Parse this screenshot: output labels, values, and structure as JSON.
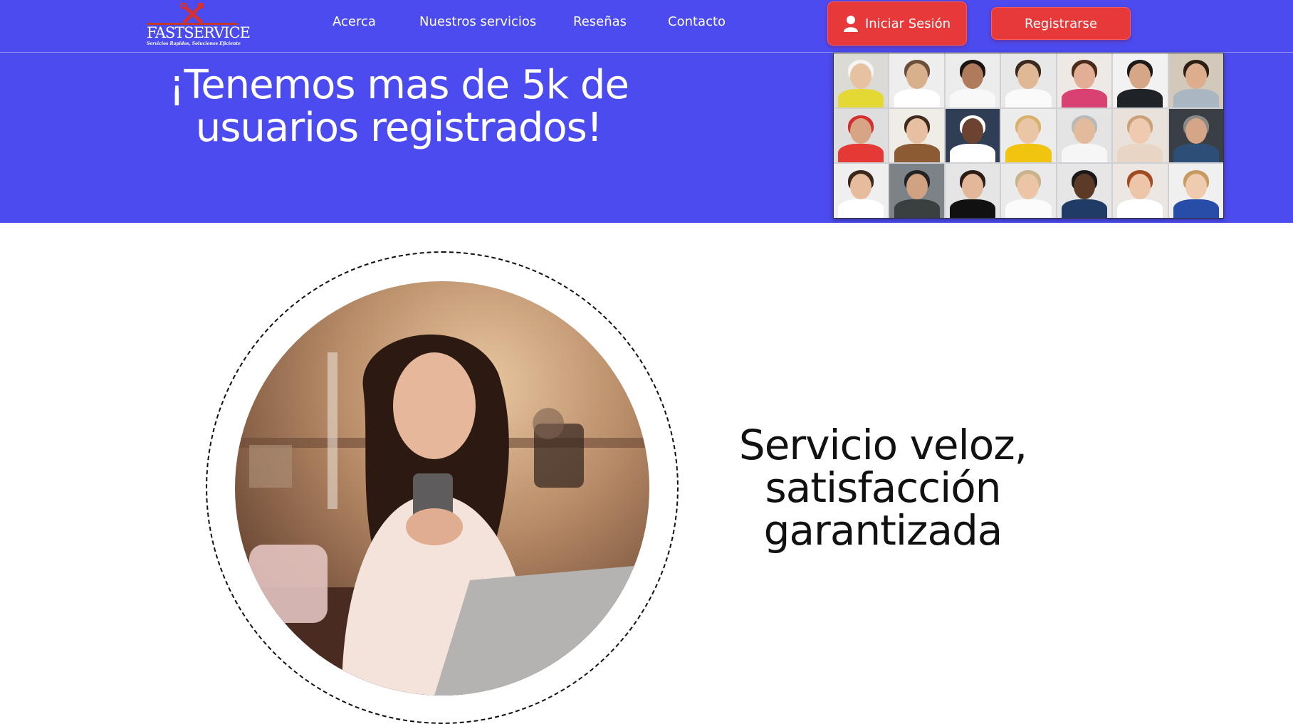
{
  "brand": {
    "name": "FASTSERVICE",
    "tagline": "Servicios Rapidos, Soluciones Eficiente",
    "accent": "#c0392b"
  },
  "nav": {
    "items": [
      {
        "label": "Acerca"
      },
      {
        "label": "Nuestros servicios"
      },
      {
        "label": "Reseñas"
      },
      {
        "label": "Contacto"
      }
    ]
  },
  "auth": {
    "login_label": "Iniciar Sesión",
    "register_label": "Registrarse",
    "button_color": "#e8393a"
  },
  "hero": {
    "title": "¡Tenemos mas de 5k de usuarios registrados!",
    "background": "#4b4bef",
    "image_semantic": "users-photo-collage"
  },
  "feature": {
    "title_lines": [
      "Servicio veloz,",
      "satisfacción",
      "garantizada"
    ],
    "image_semantic": "woman-using-phone-photo"
  }
}
